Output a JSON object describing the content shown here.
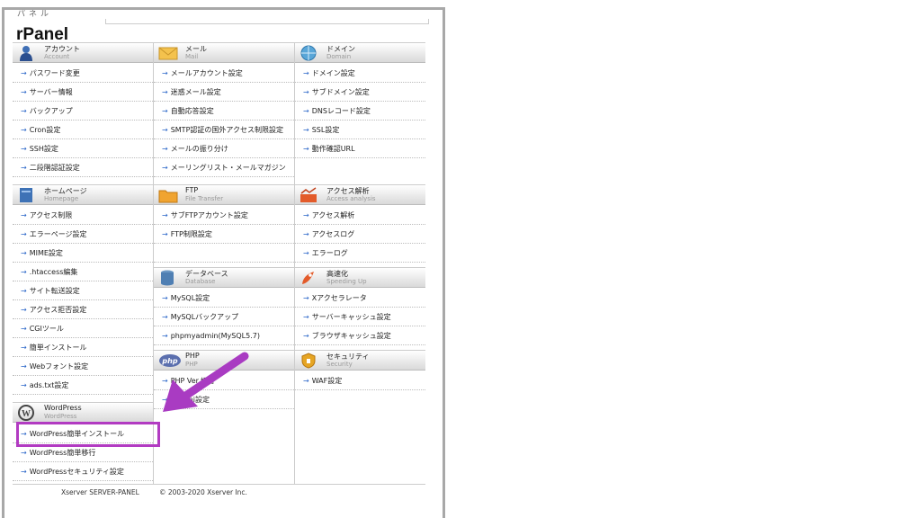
{
  "header": {
    "subtitle": "パネル",
    "brand": "rPanel"
  },
  "sections": {
    "account": {
      "title": "アカウント",
      "sub": "Account",
      "items": [
        "パスワード変更",
        "サーバー情報",
        "バックアップ",
        "Cron設定",
        "SSH設定",
        "二段階認証設定"
      ]
    },
    "homepage": {
      "title": "ホームページ",
      "sub": "Homepage",
      "items": [
        "アクセス制限",
        "エラーページ設定",
        "MIME設定",
        ".htaccess編集",
        "サイト転送設定",
        "アクセス拒否設定",
        "CGIツール",
        "簡単インストール",
        "Webフォント設定",
        "ads.txt設定"
      ]
    },
    "wordpress": {
      "title": "WordPress",
      "sub": "WordPress",
      "items": [
        "WordPress簡単インストール",
        "WordPress簡単移行",
        "WordPressセキュリティ設定"
      ]
    },
    "mail": {
      "title": "メール",
      "sub": "Mail",
      "items": [
        "メールアカウント設定",
        "迷惑メール設定",
        "自動応答設定",
        "SMTP認証の国外アクセス制限設定",
        "メールの振り分け",
        "メーリングリスト・メールマガジン"
      ]
    },
    "ftp": {
      "title": "FTP",
      "sub": "File Transfer",
      "items": [
        "サブFTPアカウント設定",
        "FTP制限設定"
      ]
    },
    "database": {
      "title": "データベース",
      "sub": "Database",
      "items": [
        "MySQL設定",
        "MySQLバックアップ",
        "phpmyadmin(MySQL5.7)"
      ]
    },
    "php": {
      "title": "PHP",
      "sub": "PHP",
      "items": [
        "PHP Ver.切替",
        "php.ini設定"
      ]
    },
    "domain": {
      "title": "ドメイン",
      "sub": "Domain",
      "items": [
        "ドメイン設定",
        "サブドメイン設定",
        "DNSレコード設定",
        "SSL設定",
        "動作確認URL"
      ]
    },
    "access": {
      "title": "アクセス解析",
      "sub": "Access analysis",
      "items": [
        "アクセス解析",
        "アクセスログ",
        "エラーログ"
      ]
    },
    "speed": {
      "title": "高速化",
      "sub": "Speeding Up",
      "items": [
        "Xアクセラレータ",
        "サーバーキャッシュ設定",
        "ブラウザキャッシュ設定"
      ]
    },
    "security": {
      "title": "セキュリティ",
      "sub": "Security",
      "items": [
        "WAF設定"
      ]
    }
  },
  "footer": {
    "left": "Xserver SERVER-PANEL",
    "right": "© 2003-2020 Xserver Inc."
  },
  "icons": {
    "account": "user-icon",
    "homepage": "page-icon",
    "wordpress": "wordpress-icon",
    "mail": "envelope-icon",
    "ftp": "folder-icon",
    "database": "database-icon",
    "php": "php-icon",
    "domain": "globe-icon",
    "access": "chart-icon",
    "speed": "rocket-icon",
    "security": "shield-icon",
    "link": "arrow-right-icon"
  },
  "colors": {
    "highlight": "#b23bc2",
    "arrow": "#a93bc2",
    "link_arrow": "#2a65c8"
  }
}
